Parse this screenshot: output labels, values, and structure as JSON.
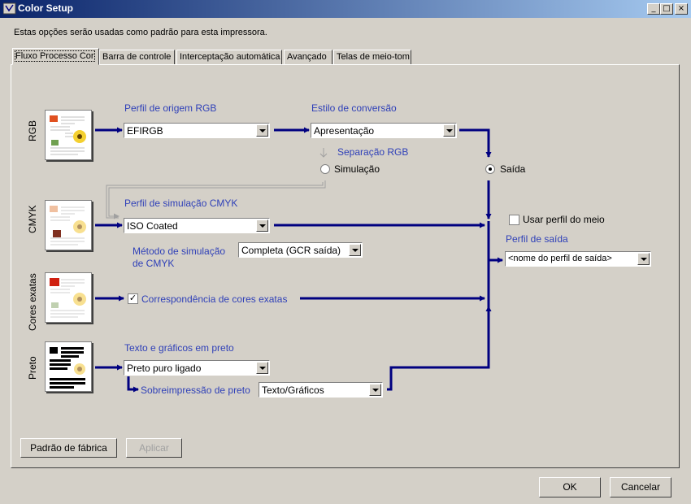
{
  "window": {
    "title": "Color Setup",
    "description": "Estas opções serão usadas como padrão para esta impressora."
  },
  "tabs": [
    {
      "label": "Fluxo Processo Cor",
      "active": true
    },
    {
      "label": "Barra de controle"
    },
    {
      "label": "Interceptação automática"
    },
    {
      "label": "Avançado"
    },
    {
      "label": "Telas de meio-tom"
    }
  ],
  "rows": {
    "rgb": "RGB",
    "cmyk": "CMYK",
    "spot": "Cores exatas",
    "black": "Preto"
  },
  "rgb": {
    "source_profile_label": "Perfil de origem RGB",
    "source_profile_value": "EFIRGB",
    "conversion_style_label": "Estilo de conversão",
    "conversion_style_value": "Apresentação",
    "separation_label": "Separação RGB",
    "simulation_label": "Simulação",
    "output_label": "Saída"
  },
  "cmyk": {
    "simulation_profile_label": "Perfil de simulação CMYK",
    "simulation_profile_value": "ISO Coated",
    "simulation_method_label_1": "Método de simulação",
    "simulation_method_label_2": "de CMYK",
    "simulation_method_value": "Completa (GCR saída)"
  },
  "spot": {
    "match_label": "Correspondência de cores exatas",
    "checked": true
  },
  "black": {
    "text_graphics_label": "Texto e gráficos em preto",
    "text_graphics_value": "Preto puro ligado",
    "overprint_label": "Sobreimpressão de preto",
    "overprint_value": "Texto/Gráficos"
  },
  "output": {
    "use_media_profile_label": "Usar perfil do meio",
    "use_media_profile_checked": false,
    "output_profile_label": "Perfil de saída",
    "output_profile_value": "<nome do perfil de saída>"
  },
  "buttons": {
    "factory_default": "Padrão de fábrica",
    "apply": "Aplicar",
    "ok": "OK",
    "cancel": "Cancelar"
  },
  "colors": {
    "flow_arrow": "#000080",
    "label_blue": "#2f40b8",
    "titlebar_start": "#0a246a"
  }
}
